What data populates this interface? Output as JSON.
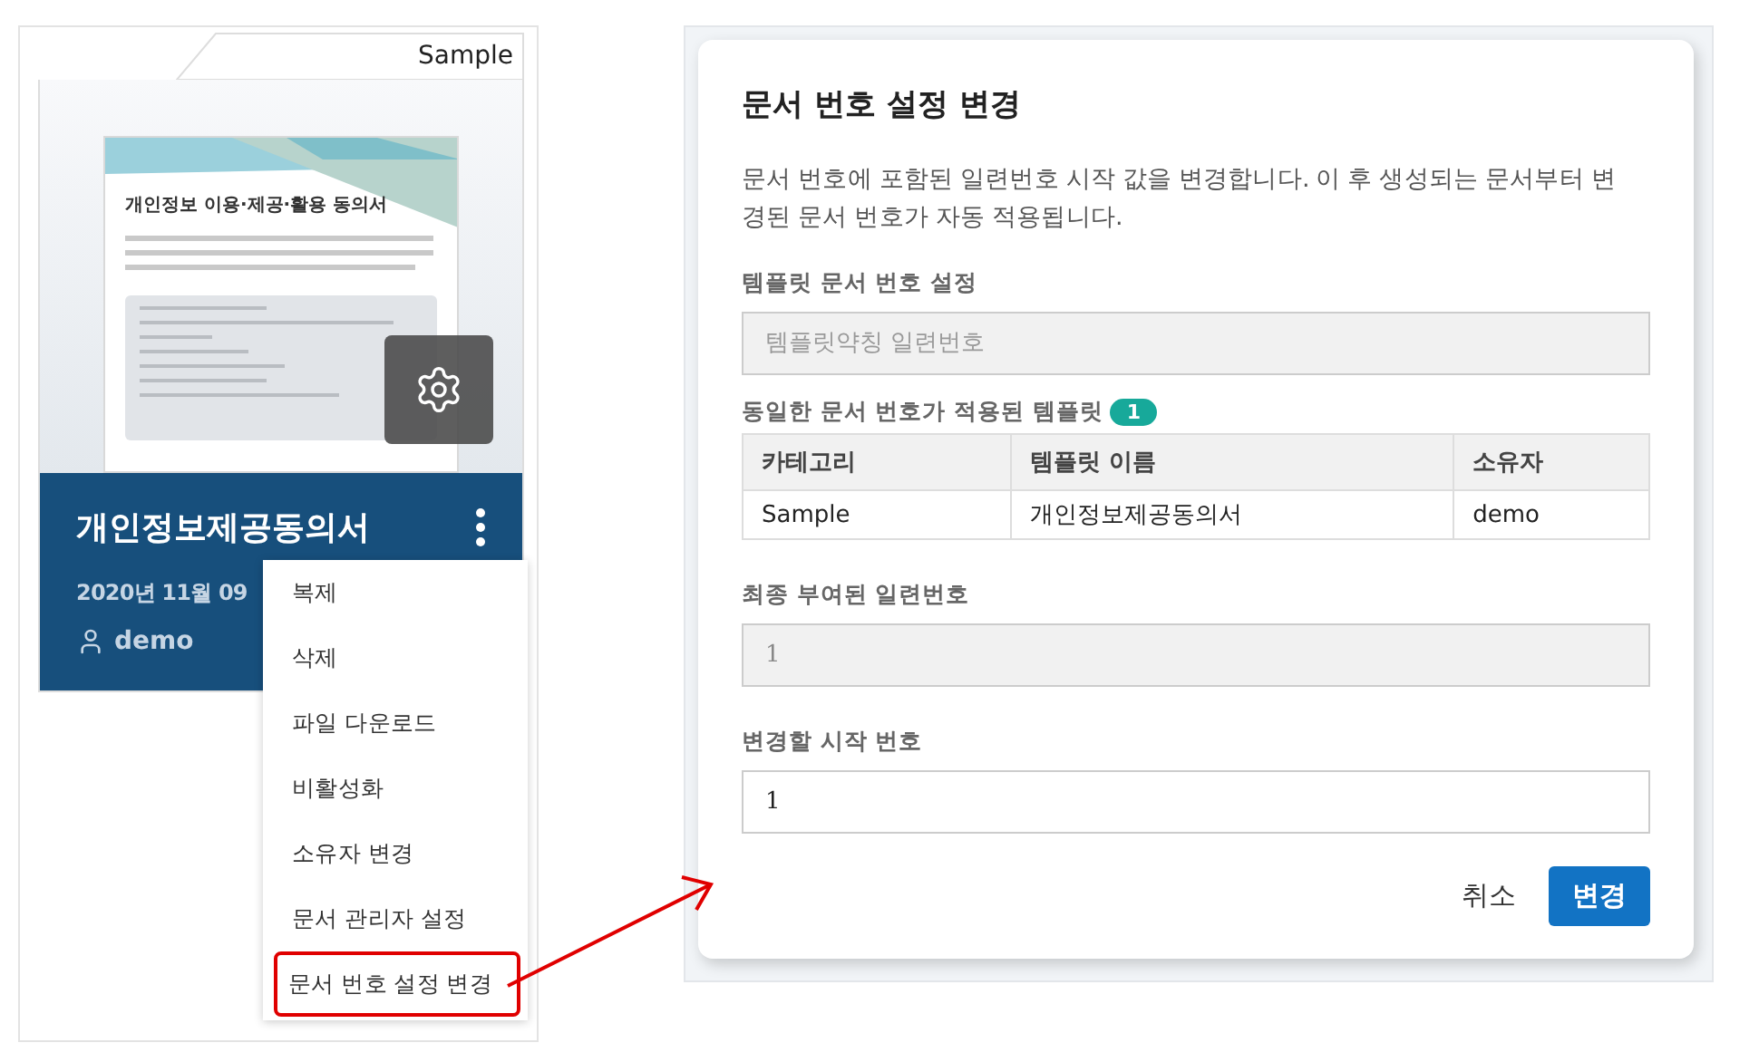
{
  "template_card": {
    "tab": "Sample",
    "doc_title": "개인정보 이용·제공·활용 동의서",
    "title": "개인정보제공동의서",
    "date": "2020년 11월 09",
    "owner": "demo"
  },
  "context_menu": {
    "items": [
      {
        "label": "복제",
        "selected": false
      },
      {
        "label": "삭제",
        "selected": false
      },
      {
        "label": "파일 다운로드",
        "selected": false
      },
      {
        "label": "비활성화",
        "selected": false
      },
      {
        "label": "소유자 변경",
        "selected": false
      },
      {
        "label": "문서 관리자 설정",
        "selected": false
      },
      {
        "label": "문서 번호 설정 변경",
        "selected": true
      }
    ]
  },
  "dialog": {
    "title": "문서 번호 설정 변경",
    "description": "문서 번호에 포함된 일련번호 시작 값을 변경합니다. 이 후 생성되는 문서부터 변경된 문서 번호가 자동 적용됩니다.",
    "sections": [
      {
        "kind": "input",
        "label": "템플릿 문서 번호 설정",
        "placeholder": "템플릿약칭 일련번호",
        "disabled": true
      },
      {
        "kind": "table",
        "label": "동일한 문서 번호가 적용된 템플릿",
        "count": "1",
        "columns": [
          "카테고리",
          "템플릿 이름",
          "소유자"
        ],
        "rows": [
          [
            "Sample",
            "개인정보제공동의서",
            "demo"
          ]
        ]
      },
      {
        "kind": "input",
        "label": "최종 부여된 일련번호",
        "value": "1",
        "disabled": true
      },
      {
        "kind": "input",
        "label": "변경할 시작 번호",
        "value": "1",
        "disabled": false
      }
    ],
    "buttons": [
      {
        "label": "취소",
        "kind": "text"
      },
      {
        "label": "변경",
        "kind": "primary"
      }
    ]
  }
}
